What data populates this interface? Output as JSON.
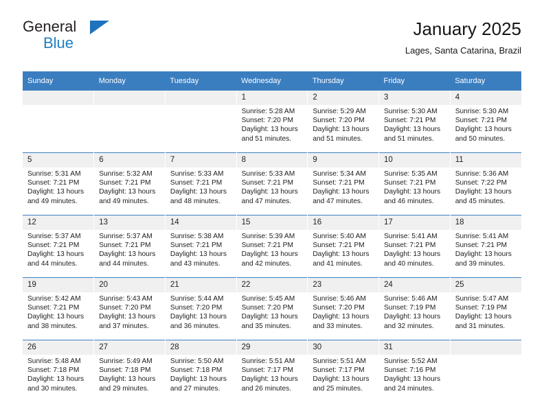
{
  "brand": {
    "name_part1": "General",
    "name_part2": "Blue",
    "logo_icon": "blue-triangle-icon",
    "accent_color": "#1f7ec4"
  },
  "header": {
    "title": "January 2025",
    "subtitle": "Lages, Santa Catarina, Brazil"
  },
  "calendar": {
    "header_bg_color": "#3b7ec0",
    "daynum_bg_color": "#f0f0f0",
    "weekday_headers": [
      "Sunday",
      "Monday",
      "Tuesday",
      "Wednesday",
      "Thursday",
      "Friday",
      "Saturday"
    ],
    "weeks": [
      [
        {
          "day": "",
          "sunrise": "",
          "sunset": "",
          "daylight_line1": "",
          "daylight_line2": ""
        },
        {
          "day": "",
          "sunrise": "",
          "sunset": "",
          "daylight_line1": "",
          "daylight_line2": ""
        },
        {
          "day": "",
          "sunrise": "",
          "sunset": "",
          "daylight_line1": "",
          "daylight_line2": ""
        },
        {
          "day": "1",
          "sunrise": "Sunrise: 5:28 AM",
          "sunset": "Sunset: 7:20 PM",
          "daylight_line1": "Daylight: 13 hours",
          "daylight_line2": "and 51 minutes."
        },
        {
          "day": "2",
          "sunrise": "Sunrise: 5:29 AM",
          "sunset": "Sunset: 7:20 PM",
          "daylight_line1": "Daylight: 13 hours",
          "daylight_line2": "and 51 minutes."
        },
        {
          "day": "3",
          "sunrise": "Sunrise: 5:30 AM",
          "sunset": "Sunset: 7:21 PM",
          "daylight_line1": "Daylight: 13 hours",
          "daylight_line2": "and 51 minutes."
        },
        {
          "day": "4",
          "sunrise": "Sunrise: 5:30 AM",
          "sunset": "Sunset: 7:21 PM",
          "daylight_line1": "Daylight: 13 hours",
          "daylight_line2": "and 50 minutes."
        }
      ],
      [
        {
          "day": "5",
          "sunrise": "Sunrise: 5:31 AM",
          "sunset": "Sunset: 7:21 PM",
          "daylight_line1": "Daylight: 13 hours",
          "daylight_line2": "and 49 minutes."
        },
        {
          "day": "6",
          "sunrise": "Sunrise: 5:32 AM",
          "sunset": "Sunset: 7:21 PM",
          "daylight_line1": "Daylight: 13 hours",
          "daylight_line2": "and 49 minutes."
        },
        {
          "day": "7",
          "sunrise": "Sunrise: 5:33 AM",
          "sunset": "Sunset: 7:21 PM",
          "daylight_line1": "Daylight: 13 hours",
          "daylight_line2": "and 48 minutes."
        },
        {
          "day": "8",
          "sunrise": "Sunrise: 5:33 AM",
          "sunset": "Sunset: 7:21 PM",
          "daylight_line1": "Daylight: 13 hours",
          "daylight_line2": "and 47 minutes."
        },
        {
          "day": "9",
          "sunrise": "Sunrise: 5:34 AM",
          "sunset": "Sunset: 7:21 PM",
          "daylight_line1": "Daylight: 13 hours",
          "daylight_line2": "and 47 minutes."
        },
        {
          "day": "10",
          "sunrise": "Sunrise: 5:35 AM",
          "sunset": "Sunset: 7:21 PM",
          "daylight_line1": "Daylight: 13 hours",
          "daylight_line2": "and 46 minutes."
        },
        {
          "day": "11",
          "sunrise": "Sunrise: 5:36 AM",
          "sunset": "Sunset: 7:22 PM",
          "daylight_line1": "Daylight: 13 hours",
          "daylight_line2": "and 45 minutes."
        }
      ],
      [
        {
          "day": "12",
          "sunrise": "Sunrise: 5:37 AM",
          "sunset": "Sunset: 7:21 PM",
          "daylight_line1": "Daylight: 13 hours",
          "daylight_line2": "and 44 minutes."
        },
        {
          "day": "13",
          "sunrise": "Sunrise: 5:37 AM",
          "sunset": "Sunset: 7:21 PM",
          "daylight_line1": "Daylight: 13 hours",
          "daylight_line2": "and 44 minutes."
        },
        {
          "day": "14",
          "sunrise": "Sunrise: 5:38 AM",
          "sunset": "Sunset: 7:21 PM",
          "daylight_line1": "Daylight: 13 hours",
          "daylight_line2": "and 43 minutes."
        },
        {
          "day": "15",
          "sunrise": "Sunrise: 5:39 AM",
          "sunset": "Sunset: 7:21 PM",
          "daylight_line1": "Daylight: 13 hours",
          "daylight_line2": "and 42 minutes."
        },
        {
          "day": "16",
          "sunrise": "Sunrise: 5:40 AM",
          "sunset": "Sunset: 7:21 PM",
          "daylight_line1": "Daylight: 13 hours",
          "daylight_line2": "and 41 minutes."
        },
        {
          "day": "17",
          "sunrise": "Sunrise: 5:41 AM",
          "sunset": "Sunset: 7:21 PM",
          "daylight_line1": "Daylight: 13 hours",
          "daylight_line2": "and 40 minutes."
        },
        {
          "day": "18",
          "sunrise": "Sunrise: 5:41 AM",
          "sunset": "Sunset: 7:21 PM",
          "daylight_line1": "Daylight: 13 hours",
          "daylight_line2": "and 39 minutes."
        }
      ],
      [
        {
          "day": "19",
          "sunrise": "Sunrise: 5:42 AM",
          "sunset": "Sunset: 7:21 PM",
          "daylight_line1": "Daylight: 13 hours",
          "daylight_line2": "and 38 minutes."
        },
        {
          "day": "20",
          "sunrise": "Sunrise: 5:43 AM",
          "sunset": "Sunset: 7:20 PM",
          "daylight_line1": "Daylight: 13 hours",
          "daylight_line2": "and 37 minutes."
        },
        {
          "day": "21",
          "sunrise": "Sunrise: 5:44 AM",
          "sunset": "Sunset: 7:20 PM",
          "daylight_line1": "Daylight: 13 hours",
          "daylight_line2": "and 36 minutes."
        },
        {
          "day": "22",
          "sunrise": "Sunrise: 5:45 AM",
          "sunset": "Sunset: 7:20 PM",
          "daylight_line1": "Daylight: 13 hours",
          "daylight_line2": "and 35 minutes."
        },
        {
          "day": "23",
          "sunrise": "Sunrise: 5:46 AM",
          "sunset": "Sunset: 7:20 PM",
          "daylight_line1": "Daylight: 13 hours",
          "daylight_line2": "and 33 minutes."
        },
        {
          "day": "24",
          "sunrise": "Sunrise: 5:46 AM",
          "sunset": "Sunset: 7:19 PM",
          "daylight_line1": "Daylight: 13 hours",
          "daylight_line2": "and 32 minutes."
        },
        {
          "day": "25",
          "sunrise": "Sunrise: 5:47 AM",
          "sunset": "Sunset: 7:19 PM",
          "daylight_line1": "Daylight: 13 hours",
          "daylight_line2": "and 31 minutes."
        }
      ],
      [
        {
          "day": "26",
          "sunrise": "Sunrise: 5:48 AM",
          "sunset": "Sunset: 7:18 PM",
          "daylight_line1": "Daylight: 13 hours",
          "daylight_line2": "and 30 minutes."
        },
        {
          "day": "27",
          "sunrise": "Sunrise: 5:49 AM",
          "sunset": "Sunset: 7:18 PM",
          "daylight_line1": "Daylight: 13 hours",
          "daylight_line2": "and 29 minutes."
        },
        {
          "day": "28",
          "sunrise": "Sunrise: 5:50 AM",
          "sunset": "Sunset: 7:18 PM",
          "daylight_line1": "Daylight: 13 hours",
          "daylight_line2": "and 27 minutes."
        },
        {
          "day": "29",
          "sunrise": "Sunrise: 5:51 AM",
          "sunset": "Sunset: 7:17 PM",
          "daylight_line1": "Daylight: 13 hours",
          "daylight_line2": "and 26 minutes."
        },
        {
          "day": "30",
          "sunrise": "Sunrise: 5:51 AM",
          "sunset": "Sunset: 7:17 PM",
          "daylight_line1": "Daylight: 13 hours",
          "daylight_line2": "and 25 minutes."
        },
        {
          "day": "31",
          "sunrise": "Sunrise: 5:52 AM",
          "sunset": "Sunset: 7:16 PM",
          "daylight_line1": "Daylight: 13 hours",
          "daylight_line2": "and 24 minutes."
        },
        {
          "day": "",
          "sunrise": "",
          "sunset": "",
          "daylight_line1": "",
          "daylight_line2": ""
        }
      ]
    ]
  }
}
